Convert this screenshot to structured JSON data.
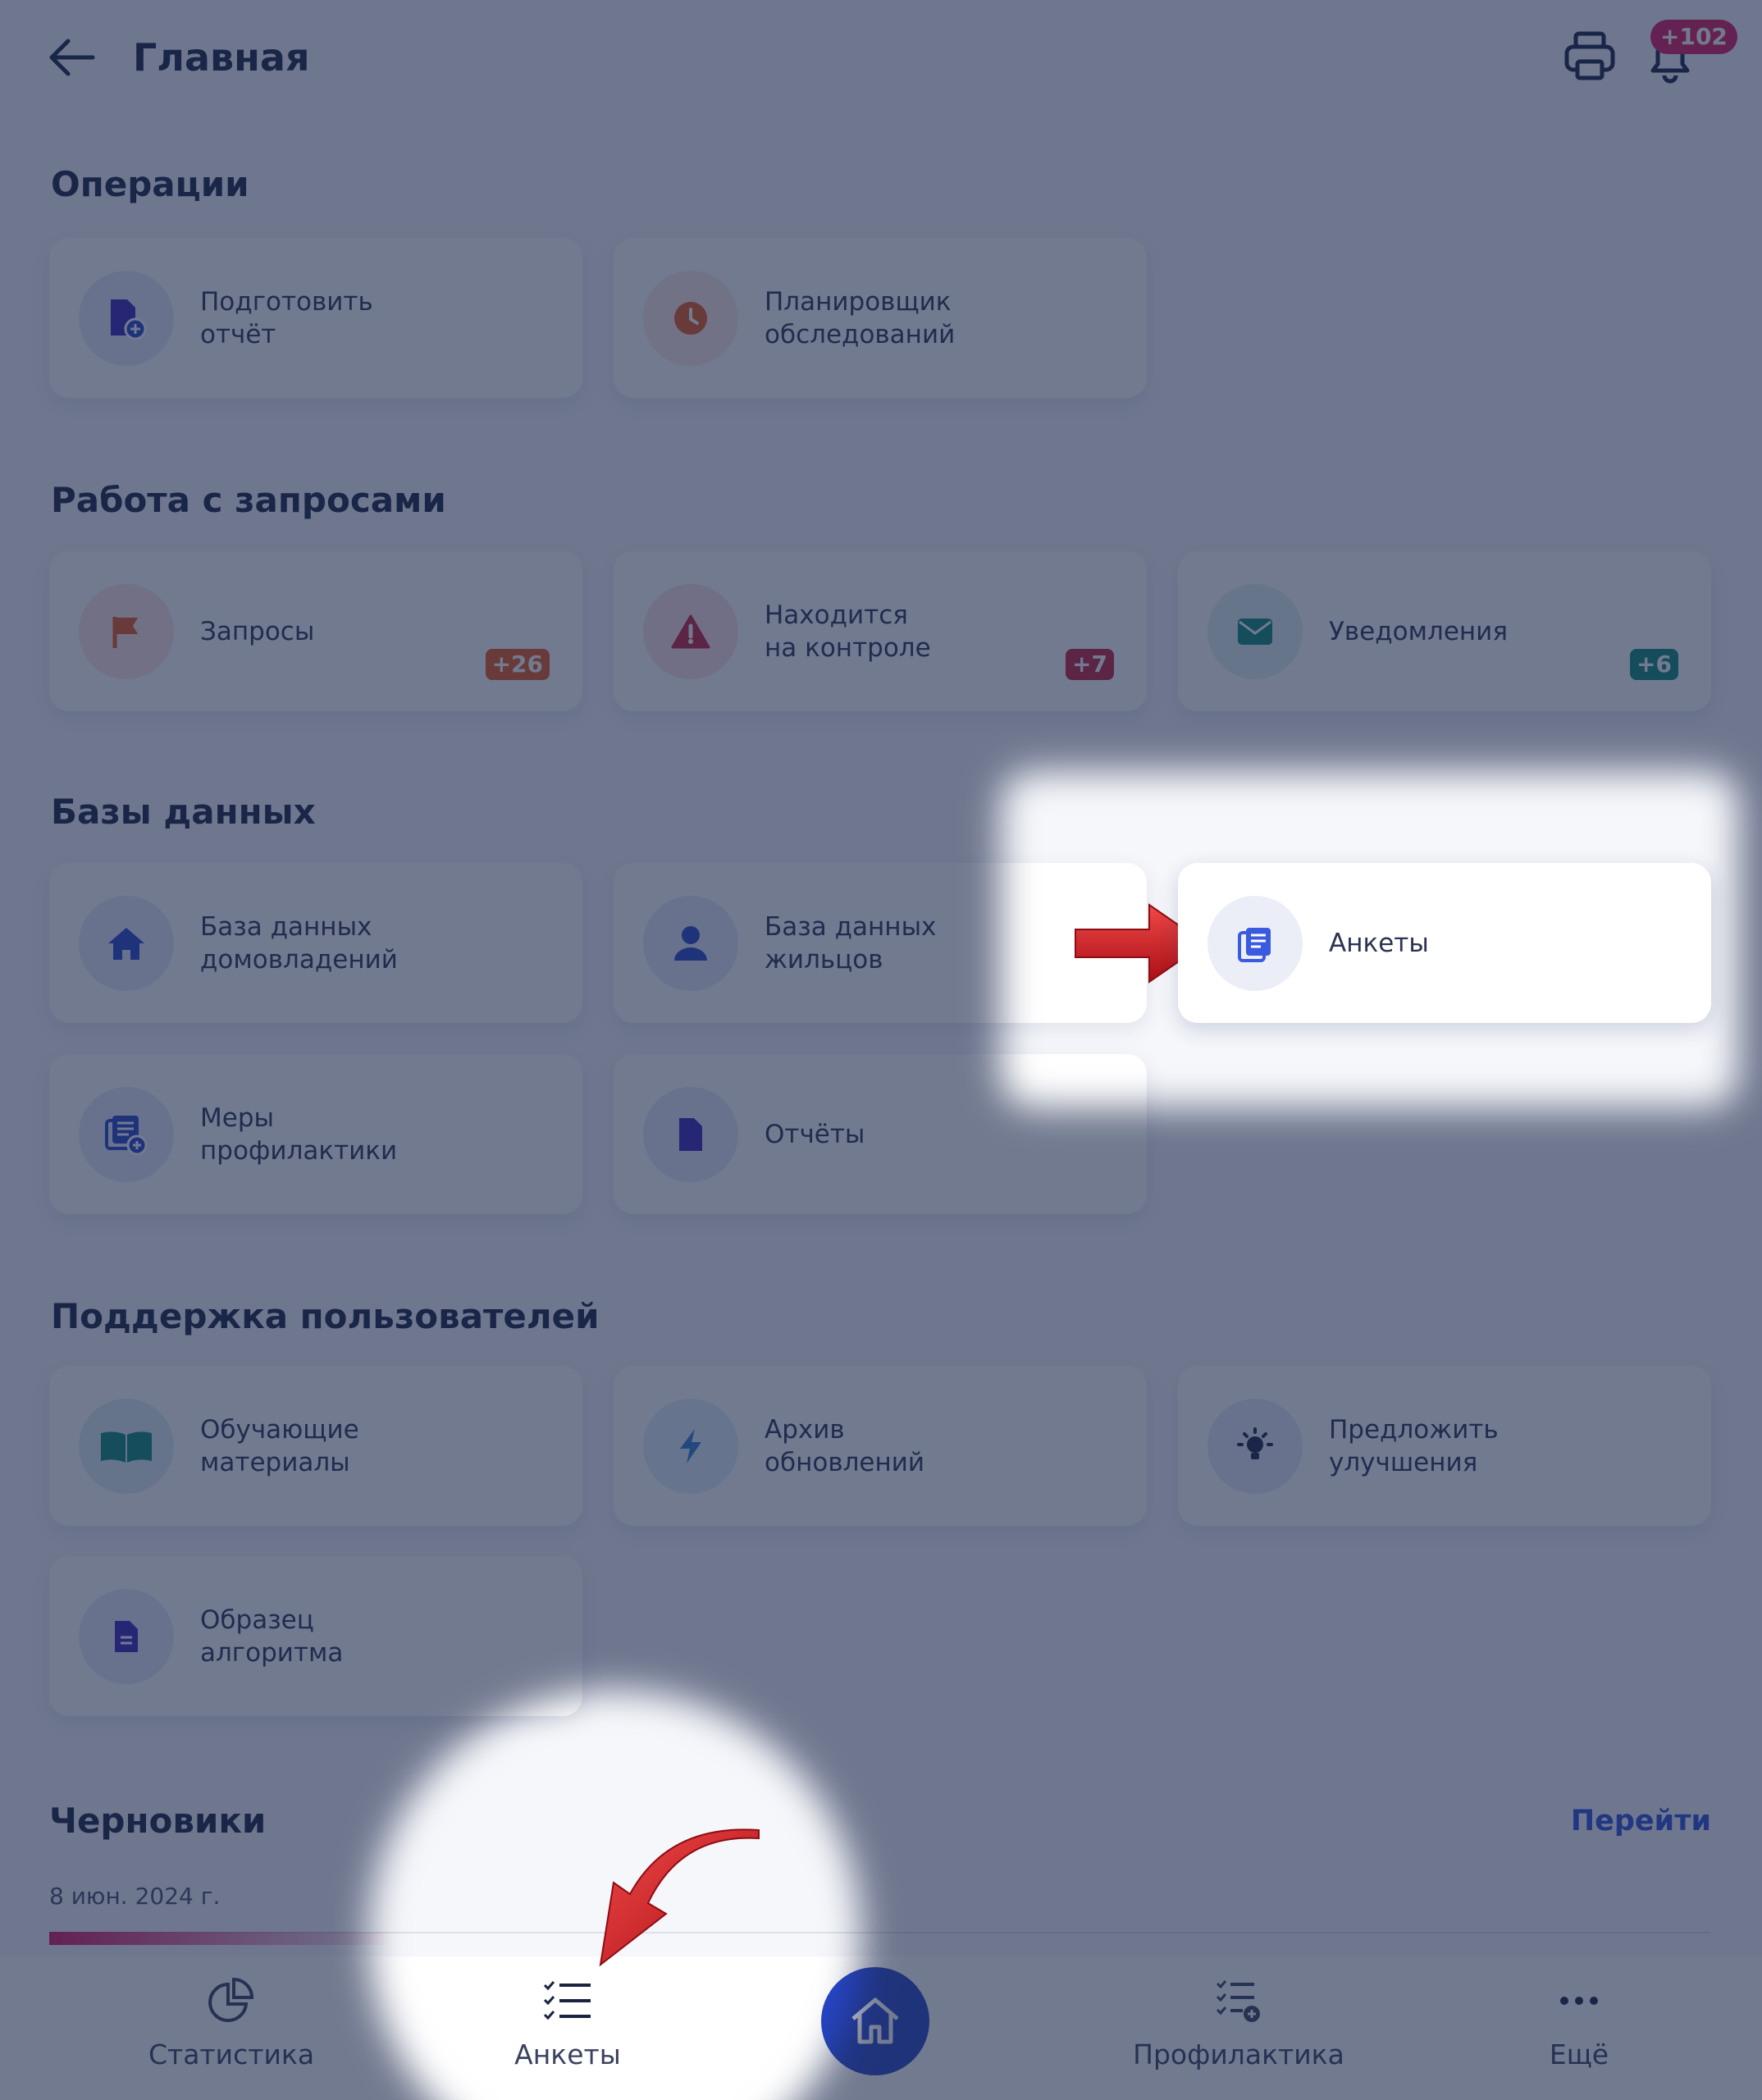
{
  "header": {
    "title": "Главная",
    "notification_count": "+102"
  },
  "sections": {
    "operations": {
      "title": "Операции",
      "items": [
        {
          "label": "Подготовить\nотчёт",
          "icon": "document-plus-icon"
        },
        {
          "label": "Планировщик\nобследований",
          "icon": "clock-icon"
        }
      ]
    },
    "requests": {
      "title": "Работа с запросами",
      "items": [
        {
          "label": "Запросы",
          "icon": "flag-icon",
          "count": "+26"
        },
        {
          "label": "Находится\nна контроле",
          "icon": "warning-icon",
          "count": "+7"
        },
        {
          "label": "Уведомления",
          "icon": "mail-icon",
          "count": "+6"
        }
      ]
    },
    "databases": {
      "title": "Базы данных",
      "items": [
        {
          "label": "База данных\nдомовладений",
          "icon": "house-icon"
        },
        {
          "label": "База данных\nжильцов",
          "icon": "person-icon"
        },
        {
          "label": "Анкеты",
          "icon": "questionnaire-icon"
        },
        {
          "label": "Меры\nпрофилактики",
          "icon": "list-plus-icon"
        },
        {
          "label": "Отчёты",
          "icon": "file-icon"
        }
      ]
    },
    "support": {
      "title": "Поддержка пользователей",
      "items": [
        {
          "label": "Обучающие\nматериалы",
          "icon": "book-icon"
        },
        {
          "label": "Архив\nобновлений",
          "icon": "bolt-icon"
        },
        {
          "label": "Предложить\nулучшения",
          "icon": "lightbulb-icon"
        },
        {
          "label": "Образец\nалгоритма",
          "icon": "document-icon"
        }
      ]
    }
  },
  "drafts": {
    "title": "Черновики",
    "goto_label": "Перейти",
    "date": "8 июн. 2024 г."
  },
  "tabbar": {
    "items": [
      {
        "label": "Статистика",
        "icon": "pie-chart-icon"
      },
      {
        "label": "Анкеты",
        "icon": "checklist-icon"
      },
      {
        "label": "",
        "icon": "home-icon"
      },
      {
        "label": "Профилактика",
        "icon": "checklist-plus-icon"
      },
      {
        "label": "Ещё",
        "icon": "more-icon"
      }
    ]
  },
  "colors": {
    "accent": "#2745c7",
    "badge_red": "#d8185b",
    "badge_orange": "#e4571c",
    "badge_crimson": "#c41e3a",
    "badge_teal": "#0e8a7a",
    "dim_overlay": "#1b284c"
  }
}
